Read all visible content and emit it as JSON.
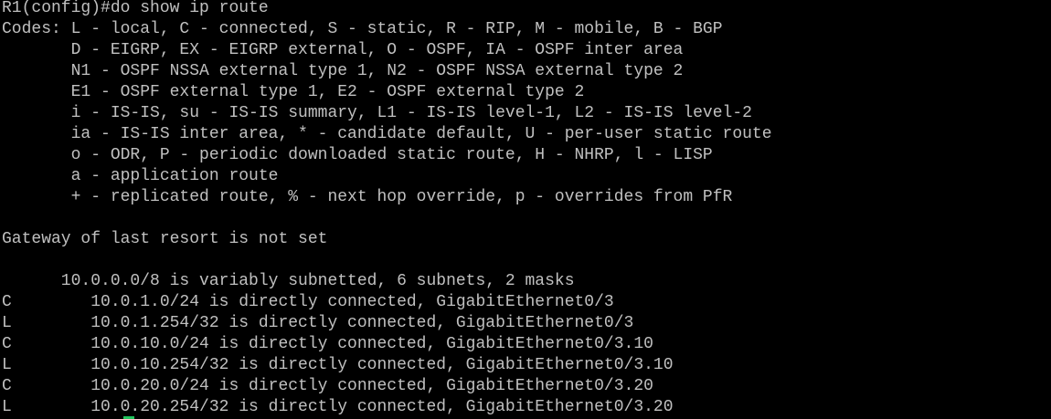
{
  "terminal": {
    "text_color": "#c0c0c0",
    "background_color": "#000000",
    "cursor_color": "#22c55e",
    "lines": [
      "R1(config)#do show ip route",
      "Codes: L - local, C - connected, S - static, R - RIP, M - mobile, B - BGP",
      "       D - EIGRP, EX - EIGRP external, O - OSPF, IA - OSPF inter area",
      "       N1 - OSPF NSSA external type 1, N2 - OSPF NSSA external type 2",
      "       E1 - OSPF external type 1, E2 - OSPF external type 2",
      "       i - IS-IS, su - IS-IS summary, L1 - IS-IS level-1, L2 - IS-IS level-2",
      "       ia - IS-IS inter area, * - candidate default, U - per-user static route",
      "       o - ODR, P - periodic downloaded static route, H - NHRP, l - LISP",
      "       a - application route",
      "       + - replicated route, % - next hop override, p - overrides from PfR",
      "",
      "Gateway of last resort is not set",
      "",
      "      10.0.0.0/8 is variably subnetted, 6 subnets, 2 masks",
      "C        10.0.1.0/24 is directly connected, GigabitEthernet0/3",
      "L        10.0.1.254/32 is directly connected, GigabitEthernet0/3",
      "C        10.0.10.0/24 is directly connected, GigabitEthernet0/3.10",
      "L        10.0.10.254/32 is directly connected, GigabitEthernet0/3.10",
      "C        10.0.20.0/24 is directly connected, GigabitEthernet0/3.20",
      "L        10.0.20.254/32 is directly connected, GigabitEthernet0/3.20"
    ]
  }
}
